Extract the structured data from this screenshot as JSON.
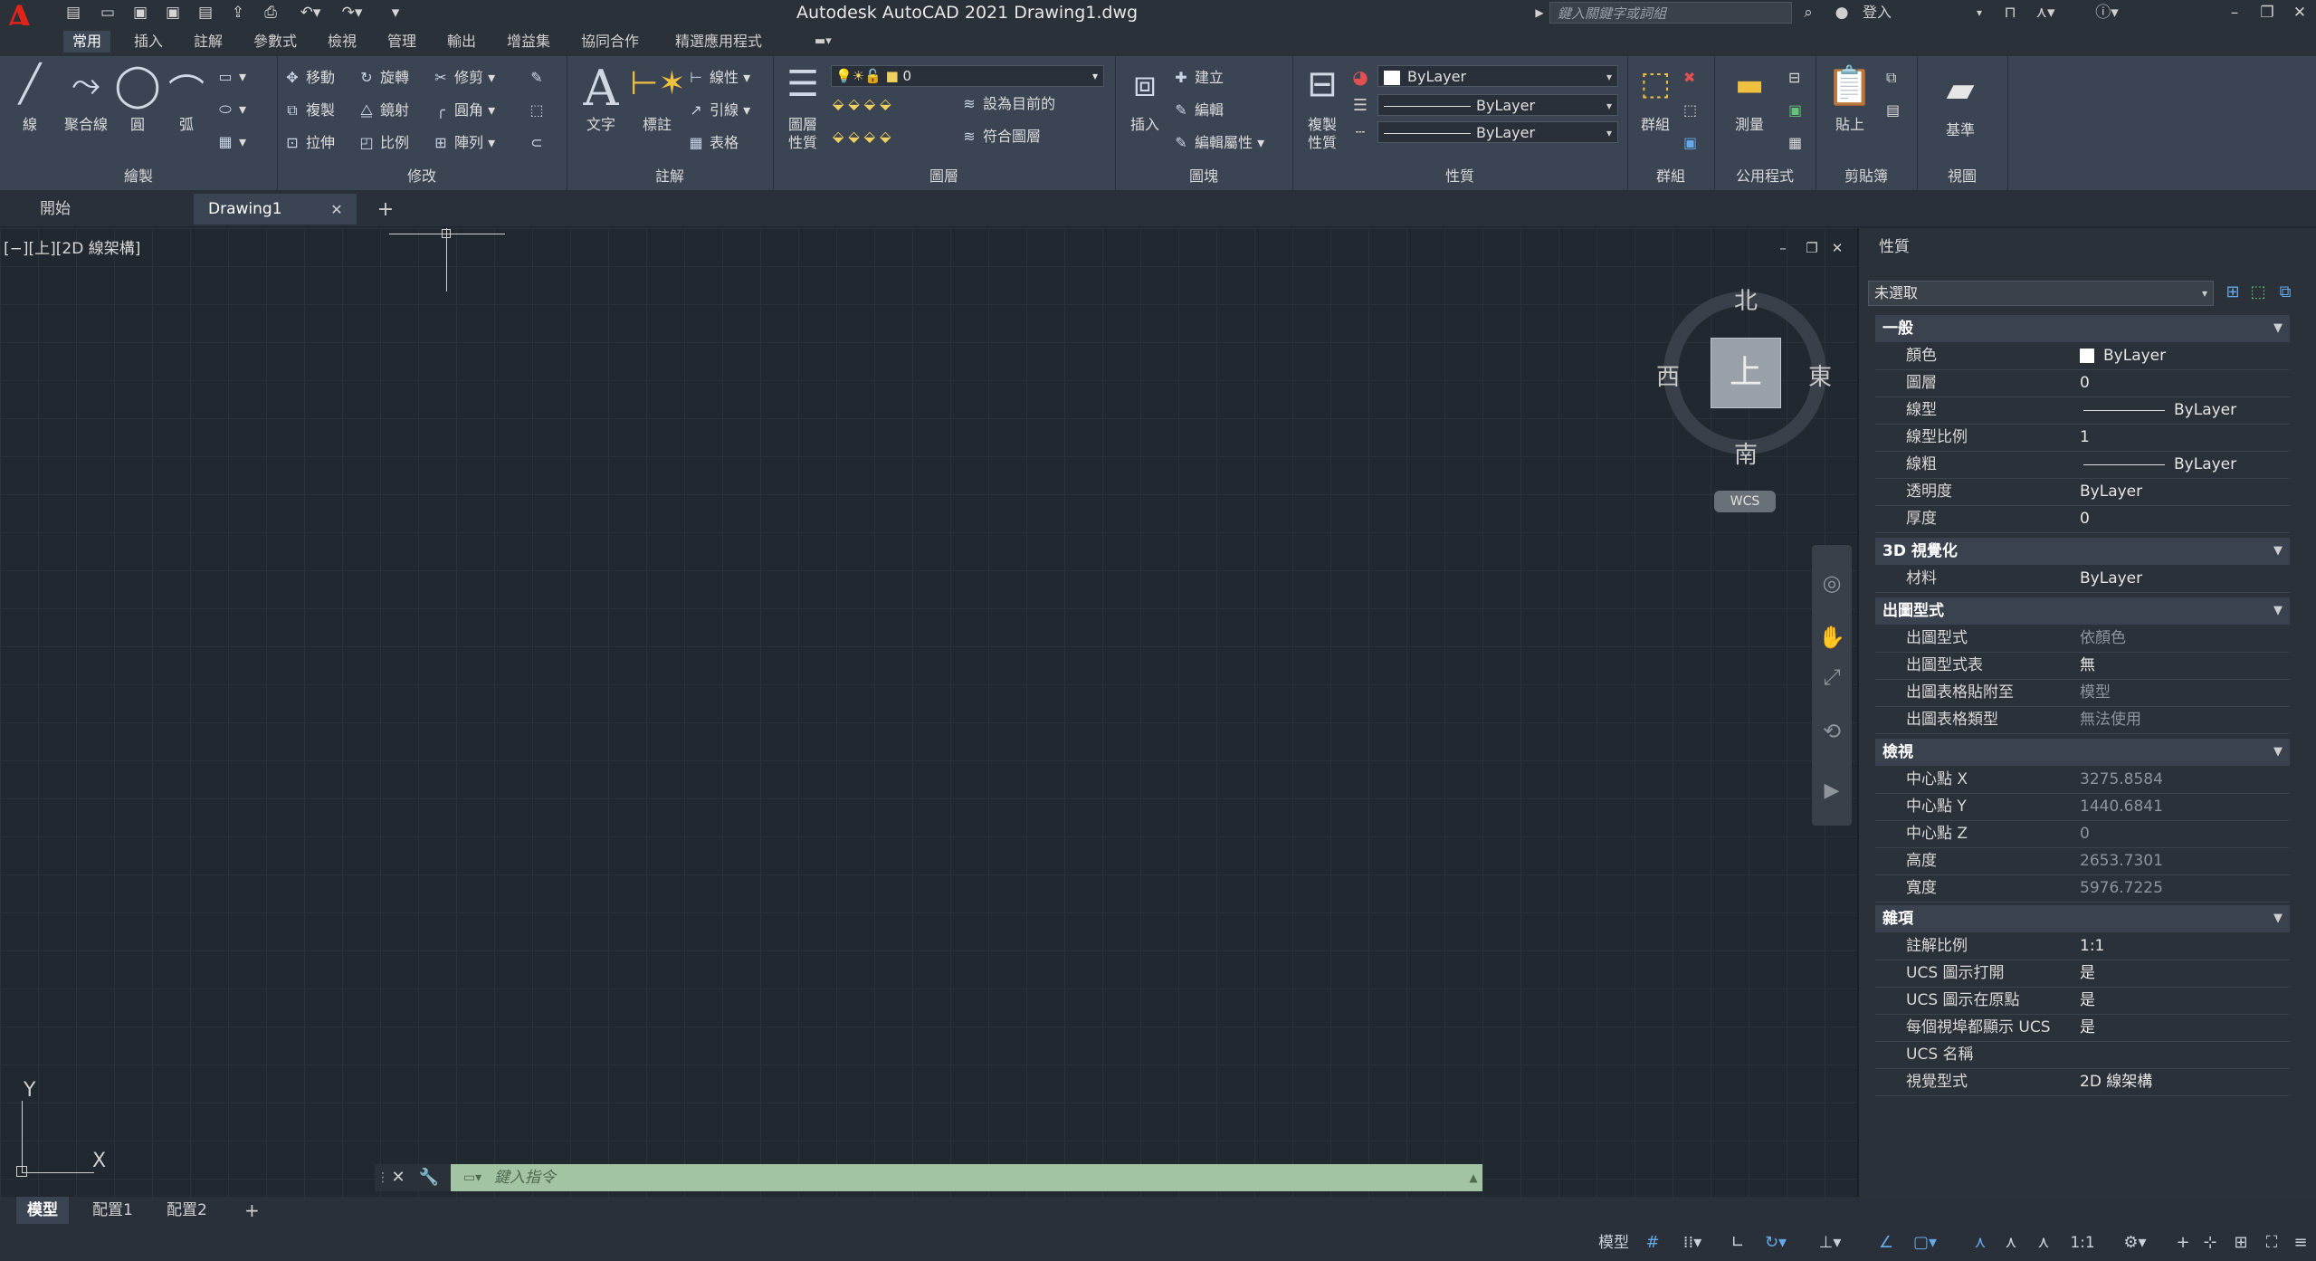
{
  "app": {
    "title": "Autodesk AutoCAD 2021    Drawing1.dwg",
    "logo_letter": "A",
    "search_placeholder": "鍵入關鍵字或詞組",
    "signin": "登入",
    "brand_color": "#e2231a"
  },
  "menu_tabs": [
    "常用",
    "插入",
    "註解",
    "參數式",
    "檢視",
    "管理",
    "輸出",
    "增益集",
    "協同合作",
    "精選應用程式"
  ],
  "ribbon": {
    "draw": {
      "title": "繪製",
      "line": "線",
      "polyline": "聚合線",
      "circle": "圓",
      "arc": "弧"
    },
    "modify": {
      "title": "修改",
      "move": "移動",
      "rotate": "旋轉",
      "trim": "修剪",
      "copy": "複製",
      "mirror": "鏡射",
      "fillet": "圓角",
      "stretch": "拉伸",
      "scale": "比例",
      "array": "陣列"
    },
    "annotation": {
      "title": "註解",
      "text": "文字",
      "dimension": "標註",
      "linear": "線性",
      "leader": "引線",
      "table": "表格"
    },
    "layers": {
      "title": "圖層",
      "layer_props": "圖層\n性質",
      "current_layer": "0",
      "set_current": "設為目前的",
      "match_layer": "符合圖層"
    },
    "block": {
      "title": "圖塊",
      "insert": "插入",
      "create": "建立",
      "edit": "編輯",
      "edit_attr": "編輯屬性"
    },
    "properties": {
      "title": "性質",
      "match_props": "複製\n性質",
      "color": "ByLayer",
      "lineweight": "ByLayer",
      "linetype": "ByLayer"
    },
    "groups": {
      "title": "群組",
      "group": "群組"
    },
    "utilities": {
      "title": "公用程式",
      "measure": "測量"
    },
    "clipboard": {
      "title": "剪貼簿",
      "paste": "貼上"
    },
    "view": {
      "title": "視圖",
      "base": "基準"
    }
  },
  "doc_tabs": {
    "start": "開始",
    "drawing": "Drawing1"
  },
  "viewport": {
    "label": "[−][上][2D 線架構]"
  },
  "viewcube": {
    "north": "北",
    "south": "南",
    "east": "東",
    "west": "西",
    "face": "上",
    "wcs": "WCS"
  },
  "ucs": {
    "x": "X",
    "y": "Y"
  },
  "command": {
    "placeholder": "鍵入指令"
  },
  "layout_tabs": [
    "模型",
    "配置1",
    "配置2"
  ],
  "status": {
    "model": "模型",
    "scale": "1:1"
  },
  "properties_palette": {
    "title": "性質",
    "selection": "未選取",
    "sections": [
      {
        "title": "一般",
        "rows": [
          {
            "name": "顏色",
            "value": "ByLayer"
          },
          {
            "name": "圖層",
            "value": "0"
          },
          {
            "name": "線型",
            "value": "ByLayer"
          },
          {
            "name": "線型比例",
            "value": "1"
          },
          {
            "name": "線粗",
            "value": "ByLayer"
          },
          {
            "name": "透明度",
            "value": "ByLayer"
          },
          {
            "name": "厚度",
            "value": "0"
          }
        ]
      },
      {
        "title": "3D 視覺化",
        "rows": [
          {
            "name": "材料",
            "value": "ByLayer"
          }
        ]
      },
      {
        "title": "出圖型式",
        "rows": [
          {
            "name": "出圖型式",
            "value": "依顏色"
          },
          {
            "name": "出圖型式表",
            "value": "無"
          },
          {
            "name": "出圖表格貼附至",
            "value": "模型"
          },
          {
            "name": "出圖表格類型",
            "value": "無法使用"
          }
        ]
      },
      {
        "title": "檢視",
        "rows": [
          {
            "name": "中心點 X",
            "value": "3275.8584"
          },
          {
            "name": "中心點 Y",
            "value": "1440.6841"
          },
          {
            "name": "中心點 Z",
            "value": "0"
          },
          {
            "name": "高度",
            "value": "2653.7301"
          },
          {
            "name": "寬度",
            "value": "5976.7225"
          }
        ]
      },
      {
        "title": "雜項",
        "rows": [
          {
            "name": "註解比例",
            "value": "1:1"
          },
          {
            "name": "UCS 圖示打開",
            "value": "是"
          },
          {
            "name": "UCS 圖示在原點",
            "value": "是"
          },
          {
            "name": "每個視埠都顯示 UCS",
            "value": "是"
          },
          {
            "name": "UCS 名稱",
            "value": ""
          },
          {
            "name": "視覺型式",
            "value": "2D 線架構"
          }
        ]
      }
    ]
  },
  "colors": {
    "background": "#212830",
    "ribbon": "#3b4453",
    "command_bg": "#a3c4a3"
  }
}
